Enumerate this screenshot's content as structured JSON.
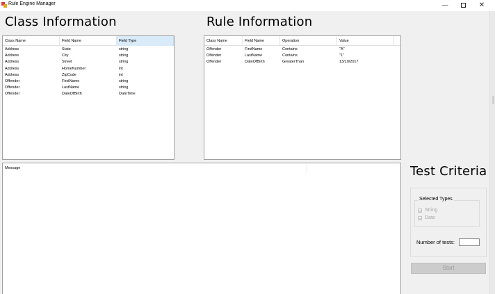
{
  "window": {
    "title": "Rule Engine Manager",
    "minimize": "—",
    "close": "✕"
  },
  "class_info": {
    "heading": "Class Information",
    "columns": [
      "Class Name",
      "Field Name",
      "Field Type"
    ],
    "rows": [
      [
        "Address",
        "State",
        "string"
      ],
      [
        "Address",
        "City",
        "string"
      ],
      [
        "Address",
        "Street",
        "string"
      ],
      [
        "Address",
        "HomeNumber",
        "int"
      ],
      [
        "Address",
        "ZipCode",
        "int"
      ],
      [
        "Offender",
        "FirstName",
        "string"
      ],
      [
        "Offender",
        "LastName",
        "string"
      ],
      [
        "Offender",
        "DateOfBirth",
        "DateTime"
      ]
    ]
  },
  "rule_info": {
    "heading": "Rule Information",
    "columns": [
      "Class Name",
      "Field Name",
      "Operation",
      "Value"
    ],
    "rows": [
      [
        "Offender",
        "FirstName",
        "Contains",
        "\"A\""
      ],
      [
        "Offender",
        "LastName",
        "Contains",
        "\"1\""
      ],
      [
        "Offender",
        "DateOfBirth",
        "GreaterThan",
        "13/10/2017"
      ]
    ]
  },
  "messages": {
    "column": "Message"
  },
  "test_criteria": {
    "heading": "Test Criteria",
    "selected_types_title": "Selected Types",
    "types": [
      {
        "label": "String",
        "checked": true,
        "enabled": false
      },
      {
        "label": "Date",
        "checked": true,
        "enabled": false
      }
    ],
    "number_of_tests_label": "Number of tests:",
    "number_of_tests_value": "",
    "start_label": "Start"
  }
}
